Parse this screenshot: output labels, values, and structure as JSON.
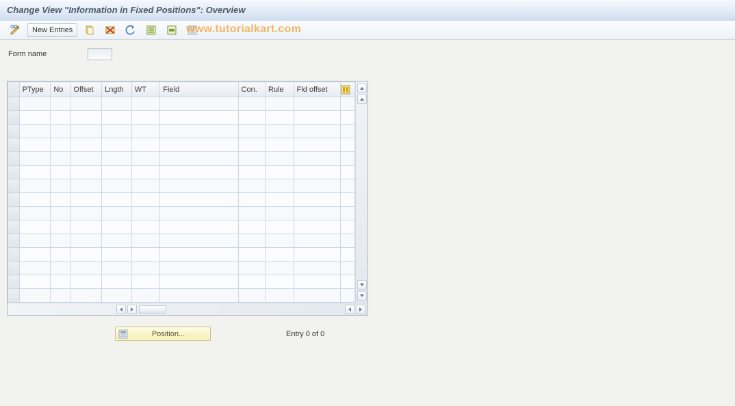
{
  "title": "Change View \"Information in Fixed Positions\": Overview",
  "toolbar": {
    "new_entries": "New Entries"
  },
  "watermark": "www.tutorialkart.com",
  "form": {
    "label_form_name": "Form name",
    "form_name_value": ""
  },
  "table": {
    "columns": [
      "PType",
      "No",
      "Offset",
      "Lngth",
      "WT",
      "Field",
      "Con.",
      "Rule",
      "Fld offset"
    ]
  },
  "footer": {
    "position_label": "Position...",
    "entry_text": "Entry 0 of 0"
  }
}
